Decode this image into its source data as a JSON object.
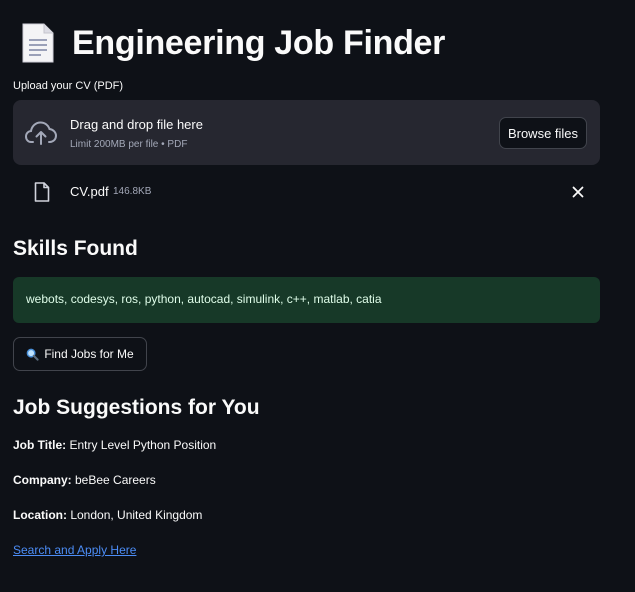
{
  "app": {
    "title": "Engineering Job Finder",
    "title_icon": "page-document-icon"
  },
  "uploader": {
    "label": "Upload your CV (PDF)",
    "drop_title": "Drag and drop file here",
    "drop_subtitle": "Limit 200MB per file • PDF",
    "browse_label": "Browse files",
    "icon": "cloud-upload-icon"
  },
  "uploaded_file": {
    "name": "CV.pdf",
    "size": "146.8KB",
    "icon": "file-icon",
    "remove_icon": "close-icon"
  },
  "skills": {
    "heading": "Skills Found",
    "list": "webots, codesys, ros, python, autocad, simulink, c++, matlab, catia"
  },
  "actions": {
    "find_jobs_label": "Find Jobs for Me",
    "find_jobs_icon": "magnifier-icon"
  },
  "jobs": {
    "heading": "Job Suggestions for You",
    "title_label": "Job Title:",
    "title_value": " Entry Level Python Position",
    "company_label": "Company:",
    "company_value": " beBee Careers",
    "location_label": "Location:",
    "location_value": " London, United Kingdom",
    "apply_link": "Search and Apply Here"
  },
  "colors": {
    "background": "#0e1117",
    "panel": "#262730",
    "success_bg": "#173928",
    "success_text": "#dffde9",
    "link": "#4c8df6"
  }
}
